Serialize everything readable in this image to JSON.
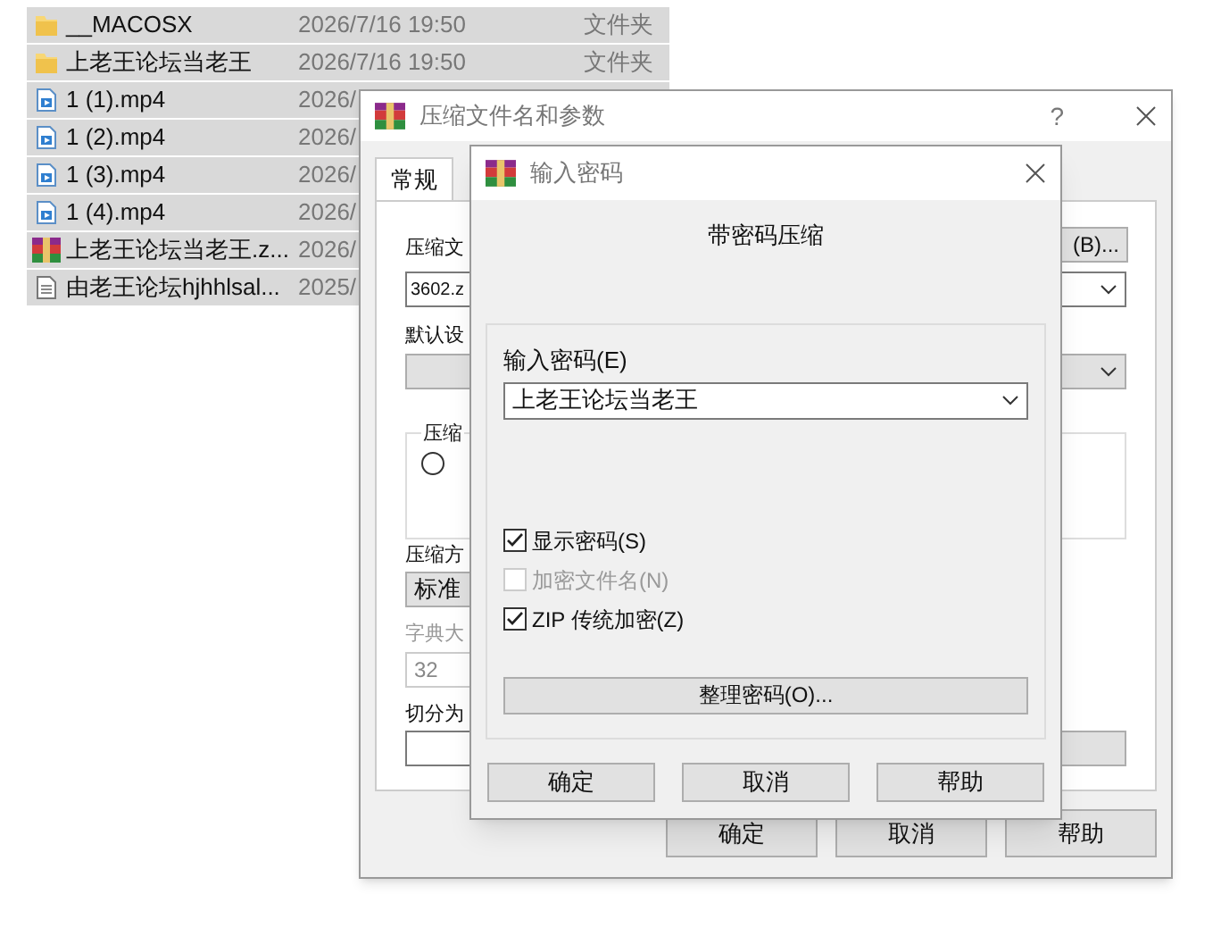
{
  "files": [
    {
      "kind": "folder",
      "name": "__MACOSX",
      "date": "2026/7/16 19:50",
      "type": "文件夹",
      "selected": true
    },
    {
      "kind": "folder",
      "name": "上老王论坛当老王",
      "date": "2026/7/16 19:50",
      "type": "文件夹",
      "selected": true
    },
    {
      "kind": "video",
      "name": "1 (1).mp4",
      "date": "2026/",
      "selected": true
    },
    {
      "kind": "video",
      "name": "1 (2).mp4",
      "date": "2026/",
      "selected": true
    },
    {
      "kind": "video",
      "name": "1 (3).mp4",
      "date": "2026/",
      "selected": true
    },
    {
      "kind": "video",
      "name": "1 (4).mp4",
      "date": "2026/",
      "selected": true
    },
    {
      "kind": "archive",
      "name": "上老王论坛当老王.z...",
      "date": "2026/",
      "selected": true
    },
    {
      "kind": "text",
      "name": "由老王论坛hjhhlsal...",
      "date": "2025/",
      "selected": true
    }
  ],
  "back_dialog": {
    "title": "压缩文件名和参数",
    "help": "?",
    "tabs": [
      {
        "label": "常规",
        "selected": true
      }
    ],
    "archive_name_label": "压缩文",
    "archive_name_value": "3602.z",
    "browse_button": "(B)...",
    "profile_label": "默认设",
    "group_label": "压缩",
    "radio_selected": false,
    "format_label": "压缩方",
    "method_value": "标准",
    "dict_label": "字典大",
    "dict_value": "32",
    "split_label": "切分为",
    "buttons": [
      "确定",
      "取消",
      "帮助"
    ]
  },
  "front_dialog": {
    "title": "输入密码",
    "heading": "带密码压缩",
    "password_label": "输入密码(E)",
    "password_value": "上老王论坛当老王",
    "options": [
      {
        "label": "显示密码(S)",
        "checked": true,
        "disabled": false
      },
      {
        "label": "加密文件名(N)",
        "checked": false,
        "disabled": true
      },
      {
        "label": "ZIP 传统加密(Z)",
        "checked": true,
        "disabled": false
      }
    ],
    "manage_button": "整理密码(O)...",
    "buttons": [
      "确定",
      "取消",
      "帮助"
    ]
  }
}
